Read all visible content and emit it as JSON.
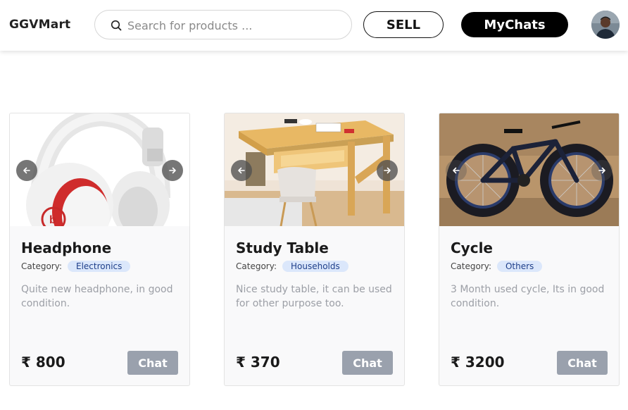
{
  "header": {
    "brand": "GGVMart",
    "search_placeholder": "Search for products ...",
    "sell_label": "SELL",
    "chats_label": "MyChats"
  },
  "colors": {
    "badge_bg": "#dbe7fb",
    "badge_text": "#1f3f8a",
    "chat_button": "#9aa1ad",
    "primary": "#000000"
  },
  "products": [
    {
      "title": "Headphone",
      "category_label": "Category:",
      "category": "Electronics",
      "description": "Quite new headphone, in good condition.",
      "price": "₹ 800",
      "chat_label": "Chat"
    },
    {
      "title": "Study Table",
      "category_label": "Category:",
      "category": "Households",
      "description": "Nice study table, it can be used for other purpose too.",
      "price": "₹ 370",
      "chat_label": "Chat"
    },
    {
      "title": "Cycle",
      "category_label": "Category:",
      "category": "Others",
      "description": "3 Month used cycle, Its in good condition.",
      "price": "₹ 3200",
      "chat_label": "Chat"
    }
  ]
}
